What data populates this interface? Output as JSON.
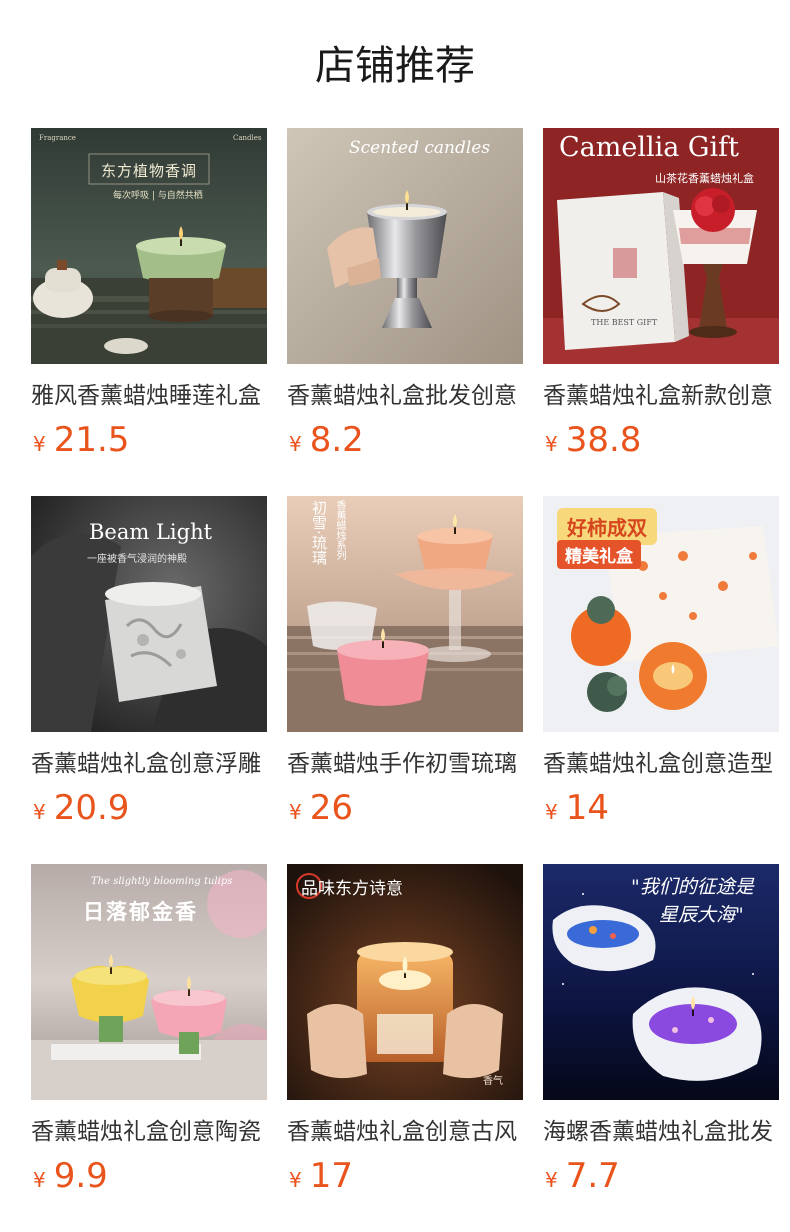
{
  "section": {
    "title": "店铺推荐"
  },
  "currency_symbol": "¥",
  "colors": {
    "price": "#e9531c",
    "title": "#1a1a1a",
    "text": "#333333"
  },
  "products": [
    {
      "name": "雅风香薰蜡烛睡莲礼盒",
      "price": "21.5",
      "image_text": [
        "东方植物香调",
        "每次呼吸 | 与自然共栖",
        "Fragrance",
        "Candles"
      ],
      "image_icon": "green-candle-teapot-image"
    },
    {
      "name": "香薰蜡烛礼盒批发创意",
      "price": "8.2",
      "image_text": [
        "Scented candles"
      ],
      "image_icon": "silver-cup-candle-image"
    },
    {
      "name": "香薰蜡烛礼盒新款创意",
      "price": "38.8",
      "image_text": [
        "Camellia Gift",
        "山茶花香薰蜡烛礼盒",
        "THE BEST GIFT"
      ],
      "image_icon": "camellia-gift-box-image"
    },
    {
      "name": "香薰蜡烛礼盒创意浮雕",
      "price": "20.9",
      "image_text": [
        "Beam Light",
        "一座被香气浸润的神殿"
      ],
      "image_icon": "relief-stone-candle-image"
    },
    {
      "name": "香薰蜡烛手作初雪琉璃",
      "price": "26",
      "image_text": [
        "初雪·琉璃",
        "香薰蜡烛系列"
      ],
      "image_icon": "glass-lotus-candle-image"
    },
    {
      "name": "香薰蜡烛礼盒创意造型",
      "price": "14",
      "image_text": [
        "好柿成双",
        "精美礼盒"
      ],
      "image_icon": "persimmon-candle-image"
    },
    {
      "name": "香薰蜡烛礼盒创意陶瓷",
      "price": "9.9",
      "image_text": [
        "The slightly blooming tulips",
        "日落郁金香"
      ],
      "image_icon": "tulip-ceramic-candle-image"
    },
    {
      "name": "香薰蜡烛礼盒创意古风",
      "price": "17",
      "image_text": [
        "品味东方诗意",
        "香气"
      ],
      "image_icon": "amber-glass-candle-image"
    },
    {
      "name": "海螺香薰蜡烛礼盒批发",
      "price": "7.7",
      "image_text": [
        "\"我们的征途是",
        "星辰大海\""
      ],
      "image_icon": "conch-shell-candle-image"
    }
  ]
}
